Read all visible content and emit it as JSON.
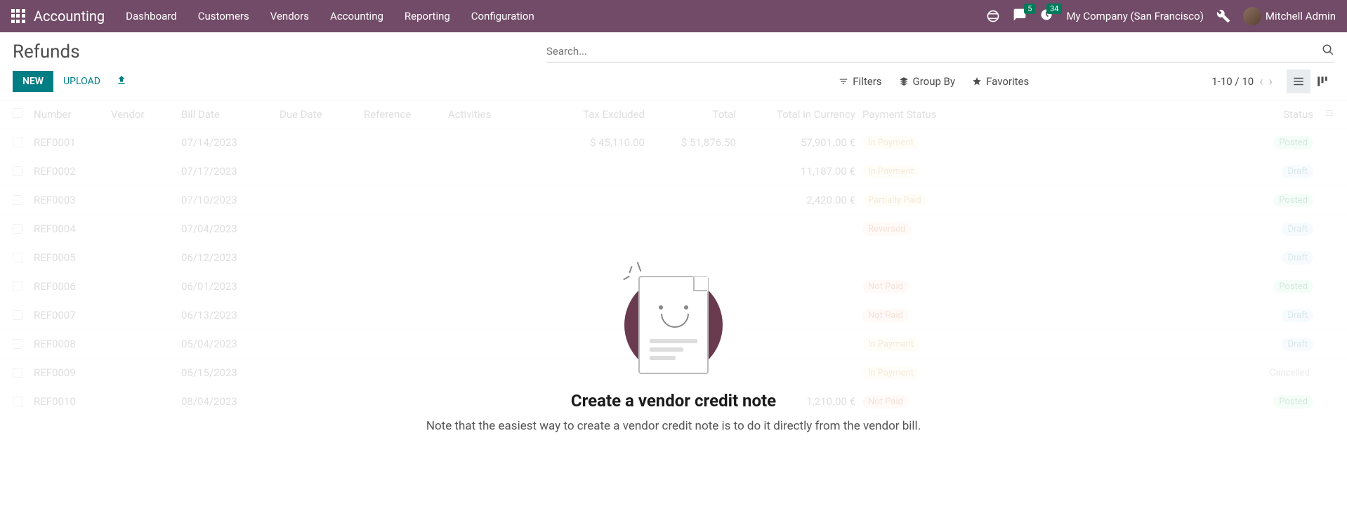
{
  "topbar": {
    "app_name": "Accounting",
    "menu": [
      "Dashboard",
      "Customers",
      "Vendors",
      "Accounting",
      "Reporting",
      "Configuration"
    ],
    "messages_badge": "5",
    "activities_badge": "34",
    "company": "My Company (San Francisco)",
    "user": "Mitchell Admin"
  },
  "header": {
    "title": "Refunds",
    "search_placeholder": "Search...",
    "btn_new": "NEW",
    "btn_upload": "UPLOAD",
    "filters": "Filters",
    "group_by": "Group By",
    "favorites": "Favorites",
    "pager": "1-10 / 10"
  },
  "table": {
    "columns": {
      "number": "Number",
      "vendor": "Vendor",
      "bill_date": "Bill Date",
      "due_date": "Due Date",
      "reference": "Reference",
      "activities": "Activities",
      "tax_excluded": "Tax Excluded",
      "total": "Total",
      "total_currency": "Total in Currency",
      "payment_status": "Payment Status",
      "status": "Status"
    },
    "rows": [
      {
        "number": "REF0001",
        "bill_date": "07/14/2023",
        "tax_excluded": "$ 45,110.00",
        "total": "$ 51,876.50",
        "total_cur": "57,901.00 €",
        "pay": "In Payment",
        "pay_class": "pill-inpayment",
        "status": "Posted",
        "status_class": "pill-posted"
      },
      {
        "number": "REF0002",
        "bill_date": "07/17/2023",
        "tax_excluded": "",
        "total": "",
        "total_cur": "11,187.00 €",
        "pay": "In Payment",
        "pay_class": "pill-inpayment",
        "status": "Draft",
        "status_class": "pill-draft"
      },
      {
        "number": "REF0003",
        "bill_date": "07/10/2023",
        "tax_excluded": "",
        "total": "",
        "total_cur": "2,420.00 €",
        "pay": "Partially Paid",
        "pay_class": "pill-partial",
        "status": "Posted",
        "status_class": "pill-posted"
      },
      {
        "number": "REF0004",
        "bill_date": "07/04/2023",
        "tax_excluded": "",
        "total": "",
        "total_cur": "",
        "pay": "Reversed",
        "pay_class": "pill-reversed",
        "status": "Draft",
        "status_class": "pill-draft"
      },
      {
        "number": "REF0005",
        "bill_date": "06/12/2023",
        "tax_excluded": "",
        "total": "",
        "total_cur": "",
        "pay": "",
        "pay_class": "",
        "status": "Draft",
        "status_class": "pill-draft"
      },
      {
        "number": "REF0006",
        "bill_date": "06/01/2023",
        "tax_excluded": "",
        "total": "",
        "total_cur": "",
        "pay": "Not Paid",
        "pay_class": "pill-notpaid",
        "status": "Posted",
        "status_class": "pill-posted"
      },
      {
        "number": "REF0007",
        "bill_date": "06/13/2023",
        "tax_excluded": "",
        "total": "",
        "total_cur": "",
        "pay": "Not Paid",
        "pay_class": "pill-notpaid",
        "status": "Draft",
        "status_class": "pill-draft"
      },
      {
        "number": "REF0008",
        "bill_date": "05/04/2023",
        "tax_excluded": "",
        "total": "",
        "total_cur": "",
        "pay": "In Payment",
        "pay_class": "pill-inpayment",
        "status": "Draft",
        "status_class": "pill-draft"
      },
      {
        "number": "REF0009",
        "bill_date": "05/15/2023",
        "tax_excluded": "",
        "total": "",
        "total_cur": "",
        "pay": "In Payment",
        "pay_class": "pill-inpayment",
        "status": "Cancelled",
        "status_class": "pill-cancelled"
      },
      {
        "number": "REF0010",
        "bill_date": "08/04/2023",
        "tax_excluded": "",
        "total": "",
        "total_cur": "1,210.00 €",
        "pay": "Not Paid",
        "pay_class": "pill-notpaid",
        "status": "Posted",
        "status_class": "pill-posted"
      }
    ]
  },
  "empty": {
    "title": "Create a vendor credit note",
    "text": "Note that the easiest way to create a vendor credit note is to do it directly from the vendor bill."
  }
}
